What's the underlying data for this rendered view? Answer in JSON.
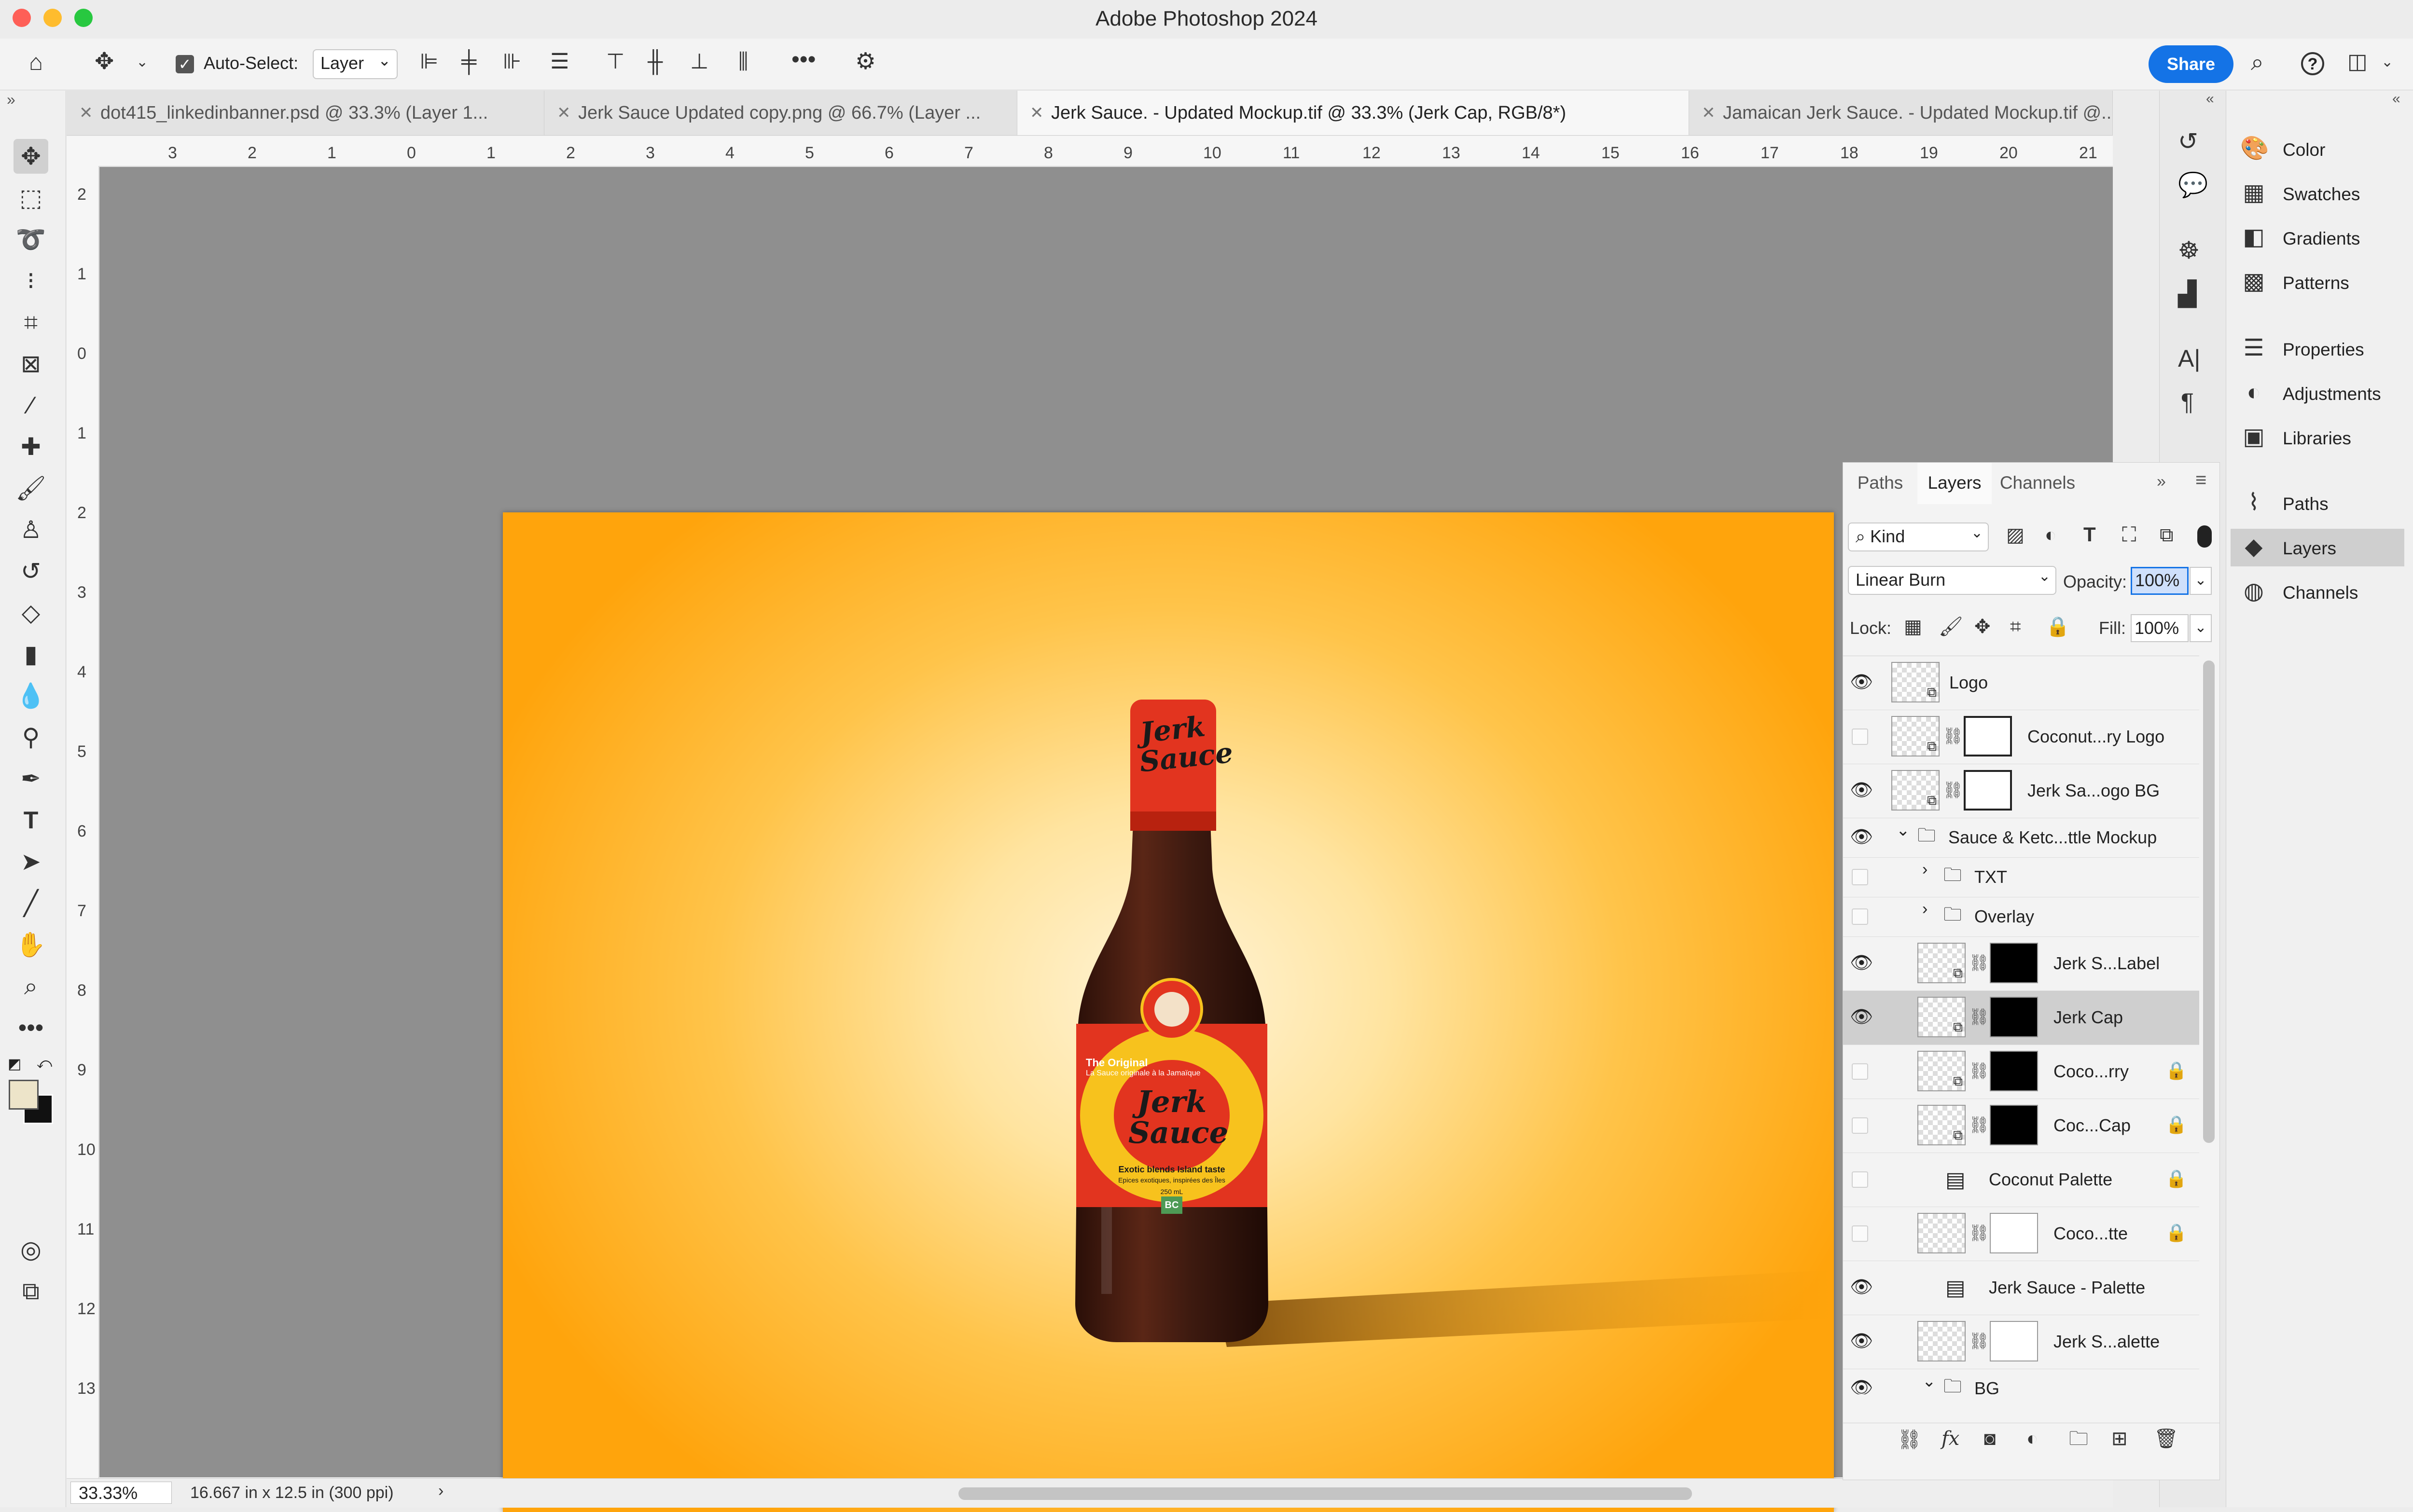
{
  "app": {
    "title": "Adobe Photoshop 2024"
  },
  "options_bar": {
    "auto_select_label": "Auto-Select:",
    "auto_select_checked": true,
    "auto_select_value": "Layer",
    "share_label": "Share"
  },
  "tabs": [
    {
      "label": "dot415_linkedinbanner.psd @ 33.3% (Layer 1...",
      "active": false
    },
    {
      "label": "Jerk Sauce Updated copy.png @ 66.7% (Layer ...",
      "active": false
    },
    {
      "label": "Jerk Sauce. - Updated Mockup.tif @ 33.3% (Jerk Cap, RGB/8*)",
      "active": true
    },
    {
      "label": "Jamaican Jerk Sauce. - Updated Mockup.tif @...",
      "active": false
    }
  ],
  "ruler_top_ticks": [
    "3",
    "2",
    "1",
    "0",
    "1",
    "2",
    "3",
    "4",
    "5",
    "6",
    "7",
    "8",
    "9",
    "10",
    "11",
    "12",
    "13",
    "14",
    "15",
    "16",
    "17",
    "18",
    "19",
    "20",
    "21"
  ],
  "ruler_left_ticks": [
    "2",
    "1",
    "0",
    "1",
    "2",
    "3",
    "4",
    "5",
    "6",
    "7",
    "8",
    "9",
    "10",
    "11",
    "12",
    "13"
  ],
  "bottle": {
    "cap_text": "Jerk Sauce",
    "label_title": "Jerk Sauce",
    "label_tagline": "The Original",
    "label_subtitle": "La Sauce originale à la Jamaïque",
    "label_footer": "Exotic blends Island taste",
    "label_footer2": "Epices exotiques, inspirées des Îles",
    "label_volume": "250 mL",
    "badge": "BC"
  },
  "status_bar": {
    "zoom": "33.33%",
    "doc_size": "16.667 in x 12.5 in (300 ppi)"
  },
  "right_panels": [
    {
      "label": "Color",
      "icon": "color-icon",
      "glyph": "🎨"
    },
    {
      "label": "Swatches",
      "icon": "swatches-icon",
      "glyph": "▦"
    },
    {
      "label": "Gradients",
      "icon": "gradients-icon",
      "glyph": "◧"
    },
    {
      "label": "Patterns",
      "icon": "patterns-icon",
      "glyph": "▩"
    },
    {
      "label": "Properties",
      "icon": "properties-icon",
      "glyph": "☰"
    },
    {
      "label": "Adjustments",
      "icon": "adjustments-icon",
      "glyph": "◐"
    },
    {
      "label": "Libraries",
      "icon": "libraries-icon",
      "glyph": "▣"
    },
    {
      "label": "Paths",
      "icon": "paths-icon",
      "glyph": "⌇"
    },
    {
      "label": "Layers",
      "icon": "layers-icon",
      "glyph": "◆"
    },
    {
      "label": "Channels",
      "icon": "channels-icon",
      "glyph": "◍"
    }
  ],
  "layers_panel": {
    "tabs": [
      "Paths",
      "Layers",
      "Channels"
    ],
    "active_tab": "Layers",
    "filter_kind": "Kind",
    "blend_mode": "Linear Burn",
    "opacity_label": "Opacity:",
    "opacity_value": "100%",
    "lock_label": "Lock:",
    "fill_label": "Fill:",
    "fill_value": "100%",
    "layers": [
      {
        "name": "Logo",
        "visible": true,
        "indent": 0,
        "type": "smart",
        "mask": "",
        "locked": false,
        "selected": false
      },
      {
        "name": "Coconut...ry Logo",
        "visible": false,
        "indent": 0,
        "type": "smart",
        "mask": "white-outline",
        "locked": false,
        "selected": false
      },
      {
        "name": "Jerk Sa...ogo BG",
        "visible": true,
        "indent": 0,
        "type": "smart",
        "mask": "white-outline",
        "locked": false,
        "selected": false
      },
      {
        "name": "Sauce & Ketc...ttle Mockup",
        "visible": true,
        "indent": 0,
        "type": "group-open",
        "mask": "",
        "locked": false,
        "selected": false
      },
      {
        "name": "TXT",
        "visible": false,
        "indent": 1,
        "type": "group-closed",
        "mask": "",
        "locked": false,
        "selected": false
      },
      {
        "name": "Overlay",
        "visible": false,
        "indent": 1,
        "type": "group-closed",
        "mask": "",
        "locked": false,
        "selected": false
      },
      {
        "name": "Jerk S...Label",
        "visible": true,
        "indent": 1,
        "type": "smart",
        "mask": "black",
        "locked": false,
        "selected": false
      },
      {
        "name": "Jerk Cap",
        "visible": true,
        "indent": 1,
        "type": "smart",
        "mask": "black",
        "locked": false,
        "selected": true
      },
      {
        "name": "Coco...rry",
        "visible": false,
        "indent": 1,
        "type": "smart",
        "mask": "black",
        "locked": true,
        "selected": false
      },
      {
        "name": "Coc...Cap",
        "visible": false,
        "indent": 1,
        "type": "smart",
        "mask": "black",
        "locked": true,
        "selected": false
      },
      {
        "name": "Coconut Palette",
        "visible": false,
        "indent": 1,
        "type": "adjust",
        "mask": "",
        "locked": true,
        "selected": false
      },
      {
        "name": "Coco...tte",
        "visible": false,
        "indent": 1,
        "type": "pixel",
        "mask": "white",
        "locked": true,
        "selected": false
      },
      {
        "name": "Jerk Sauce - Palette",
        "visible": true,
        "indent": 1,
        "type": "adjust",
        "mask": "",
        "locked": false,
        "selected": false
      },
      {
        "name": "Jerk S...alette",
        "visible": true,
        "indent": 1,
        "type": "pixel",
        "mask": "white",
        "locked": false,
        "selected": false
      },
      {
        "name": "BG",
        "visible": true,
        "indent": 1,
        "type": "group-open",
        "mask": "",
        "locked": false,
        "selected": false
      }
    ]
  },
  "colors": {
    "accent": "#1473e6",
    "canvas_bg": "#8f8f8f",
    "selected_row": "#cfcfcf",
    "bottle_body": "#3d1a10",
    "cap": "#e2341f",
    "label_red": "#e2341f",
    "label_yellow": "#f7c21d"
  }
}
